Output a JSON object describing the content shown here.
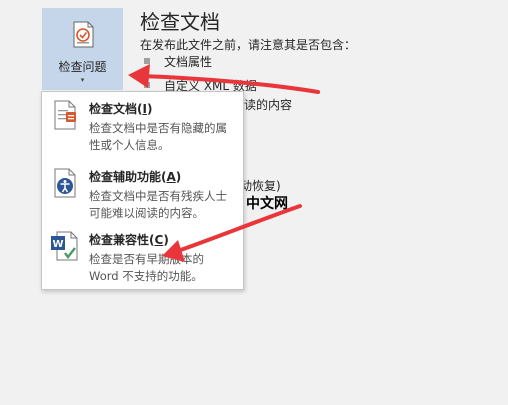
{
  "ribbon": {
    "inspect_button_label": "检查问题",
    "caret": "▾"
  },
  "info_panel": {
    "title": "检查文档",
    "description": "在发布此文件之前，请注意其是否包含：",
    "items": [
      "文档属性",
      "自定义 XML 数据"
    ],
    "partial_line_1": "阅读的内容",
    "partial_line_2": "动恢复)"
  },
  "menu": {
    "items": [
      {
        "title": "检查文档",
        "accel": "I",
        "description": "检查文档中是否有隐藏的属性或个人信息。"
      },
      {
        "title": "检查辅助功能",
        "accel": "A",
        "description": "检查文档中是否有残疾人士可能难以阅读的内容。"
      },
      {
        "title": "检查兼容性",
        "accel": "C",
        "description": "检查是否有早期版本的 Word 不支持的功能。"
      }
    ]
  },
  "watermark": {
    "logo_text": "php",
    "text": "中文网"
  },
  "colors": {
    "button_highlight": "#c5d5ea",
    "arrow_red": "#e8363a",
    "icon_blue": "#2b5797",
    "icon_orange": "#d9572e",
    "watermark_blue": "#4f6cb5"
  }
}
